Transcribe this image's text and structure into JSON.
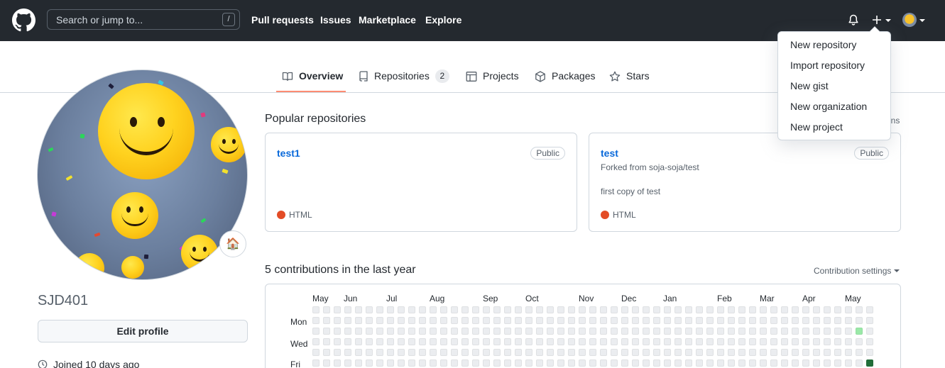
{
  "header": {
    "search_placeholder": "Search or jump to...",
    "search_shortcut": "/",
    "nav": [
      "Pull requests",
      "Issues",
      "Marketplace",
      "Explore"
    ]
  },
  "create_menu": {
    "items": [
      "New repository",
      "Import repository",
      "New gist",
      "New organization",
      "New project"
    ]
  },
  "tabs": [
    {
      "label": "Overview",
      "icon": "book-icon",
      "selected": true
    },
    {
      "label": "Repositories",
      "icon": "repo-icon",
      "count": "2"
    },
    {
      "label": "Projects",
      "icon": "table-icon"
    },
    {
      "label": "Packages",
      "icon": "package-icon"
    },
    {
      "label": "Stars",
      "icon": "star-icon"
    }
  ],
  "profile": {
    "username": "SJD401",
    "edit_label": "Edit profile",
    "joined": "Joined 10 days ago",
    "status_emoji": "🏠"
  },
  "popular": {
    "title": "Popular repositories",
    "customize_label": "ins",
    "repos": [
      {
        "name": "test1",
        "visibility": "Public",
        "forked_from": "",
        "description": "",
        "language": "HTML",
        "language_color": "#e34c26"
      },
      {
        "name": "test",
        "visibility": "Public",
        "forked_from": "Forked from soja-soja/test",
        "description": "first copy of test",
        "language": "HTML",
        "language_color": "#e34c26"
      }
    ]
  },
  "contributions": {
    "title": "5 contributions in the last year",
    "settings_label": "Contribution settings",
    "months": [
      "May",
      "Jun",
      "Jul",
      "Aug",
      "Sep",
      "Oct",
      "Nov",
      "Dec",
      "Jan",
      "Feb",
      "Mar",
      "Apr",
      "May"
    ],
    "days": [
      "Mon",
      "Wed",
      "Fri"
    ],
    "colors": {
      "empty": "#ebedf0",
      "level1": "#9be9a8",
      "level4": "#216e39"
    },
    "highlighted": [
      {
        "week": 51,
        "day": 2,
        "level": 1
      },
      {
        "week": 52,
        "day": 5,
        "level": 4
      }
    ]
  }
}
